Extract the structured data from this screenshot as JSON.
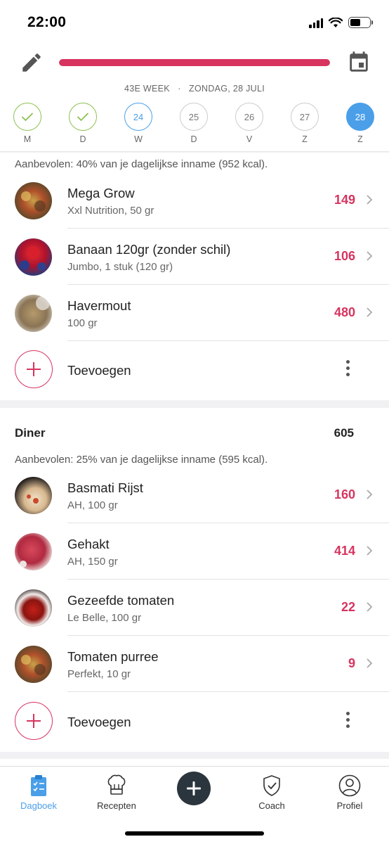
{
  "status_bar": {
    "time": "22:00"
  },
  "header": {
    "progress_fraction": 1.0,
    "week_label": "43E WEEK",
    "separator": "·",
    "date_label": "ZONDAG, 28 JULI",
    "days": [
      {
        "letter": "M",
        "number": "",
        "state": "done"
      },
      {
        "letter": "D",
        "number": "",
        "state": "done"
      },
      {
        "letter": "W",
        "number": "24",
        "state": "today"
      },
      {
        "letter": "D",
        "number": "25",
        "state": "future"
      },
      {
        "letter": "V",
        "number": "26",
        "state": "future"
      },
      {
        "letter": "Z",
        "number": "27",
        "state": "future"
      },
      {
        "letter": "Z",
        "number": "28",
        "state": "selected"
      }
    ]
  },
  "breakfast": {
    "recommendation": "Aanbevolen: 40% van je dagelijkse inname (952 kcal).",
    "items": [
      {
        "name": "Mega Grow",
        "detail": "Xxl Nutrition, 50 gr",
        "kcal": "149",
        "image": "spices-thumb"
      },
      {
        "name": "Banaan 120gr (zonder schil)",
        "detail": "Jumbo, 1 stuk (120 gr)",
        "kcal": "106",
        "image": "berries-thumb"
      },
      {
        "name": "Havermout",
        "detail": "100 gr",
        "kcal": "480",
        "image": "grain-thumb"
      }
    ],
    "add_label": "Toevoegen"
  },
  "dinner": {
    "title": "Diner",
    "total": "605",
    "recommendation": "Aanbevolen: 25% van je dagelijkse inname (595 kcal).",
    "items": [
      {
        "name": "Basmati Rijst",
        "detail": "AH, 100 gr",
        "kcal": "160",
        "image": "pizza-thumb"
      },
      {
        "name": "Gehakt",
        "detail": "AH, 150 gr",
        "kcal": "414",
        "image": "meat-thumb"
      },
      {
        "name": "Gezeefde tomaten",
        "detail": "Le Belle, 100 gr",
        "kcal": "22",
        "image": "soup-thumb"
      },
      {
        "name": "Tomaten purree",
        "detail": "Perfekt, 10 gr",
        "kcal": "9",
        "image": "spices-thumb"
      }
    ],
    "add_label": "Toevoegen"
  },
  "tabbar": {
    "tabs": [
      {
        "label": "Dagboek",
        "icon": "clipboard-icon",
        "active": true
      },
      {
        "label": "Recepten",
        "icon": "chef-hat-icon",
        "active": false
      },
      {
        "label": "Coach",
        "icon": "shield-check-icon",
        "active": false
      },
      {
        "label": "Profiel",
        "icon": "person-icon",
        "active": false
      }
    ]
  },
  "colors": {
    "accent": "#d7345f",
    "blue": "#4a9fe8",
    "green": "#8cc152",
    "fab": "#2b353d"
  }
}
